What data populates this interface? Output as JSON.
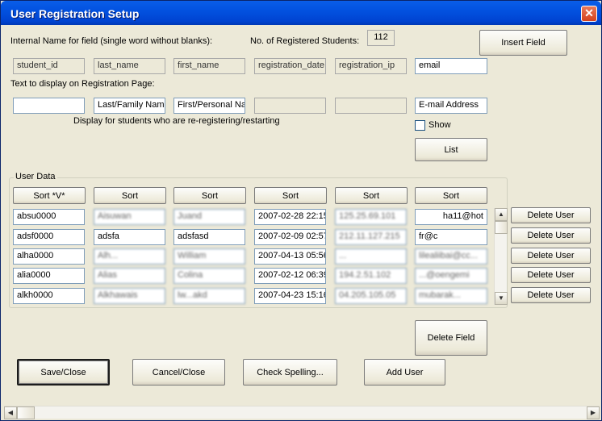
{
  "window": {
    "title": "User Registration Setup",
    "close_label": "✕"
  },
  "labels": {
    "internal_name": "Internal Name for field (single word without blanks):",
    "registered_students": "No. of Registered Students:",
    "registered_count": "112",
    "display_text": "Text to display on Registration Page:",
    "reregister": "Display for students who are re-registering/restarting",
    "show": "Show",
    "user_data": "User Data"
  },
  "buttons": {
    "insert_field": "Insert Field",
    "list": "List",
    "delete_field": "Delete Field",
    "save_close": "Save/Close",
    "cancel_close": "Cancel/Close",
    "check_spelling": "Check Spelling...",
    "add_user": "Add User",
    "delete_user": "Delete User"
  },
  "internal_fields": [
    "student_id",
    "last_name",
    "first_name",
    "registration_date",
    "registration_ip",
    "email"
  ],
  "display_fields": [
    "",
    "Last/Family Name",
    "First/Personal Nar",
    "",
    "",
    "E-mail Address"
  ],
  "sort_headers": [
    "Sort  *V*",
    "Sort",
    "Sort",
    "Sort",
    "Sort",
    "Sort"
  ],
  "rows": [
    [
      "absu0000",
      "Aisuwan",
      "Juand",
      "2007-02-28 22:15",
      "125.25.69.101",
      "ha11@hot"
    ],
    [
      "adsf0000",
      "adsfa",
      "adsfasd",
      "2007-02-09 02:57",
      "212.11.127.215",
      "fr@c"
    ],
    [
      "alha0000",
      "Alh...",
      "William",
      "2007-04-13 05:56",
      "...",
      "lilealiibai@cc..."
    ],
    [
      "alia0000",
      "Alias",
      "Colina",
      "2007-02-12 06:39",
      "194.2.51.102",
      "...@oengemi"
    ],
    [
      "alkh0000",
      "Alkhawais",
      "lw...akd",
      "2007-04-23 15:16",
      "04.205.105.05",
      "mubarak..."
    ]
  ]
}
